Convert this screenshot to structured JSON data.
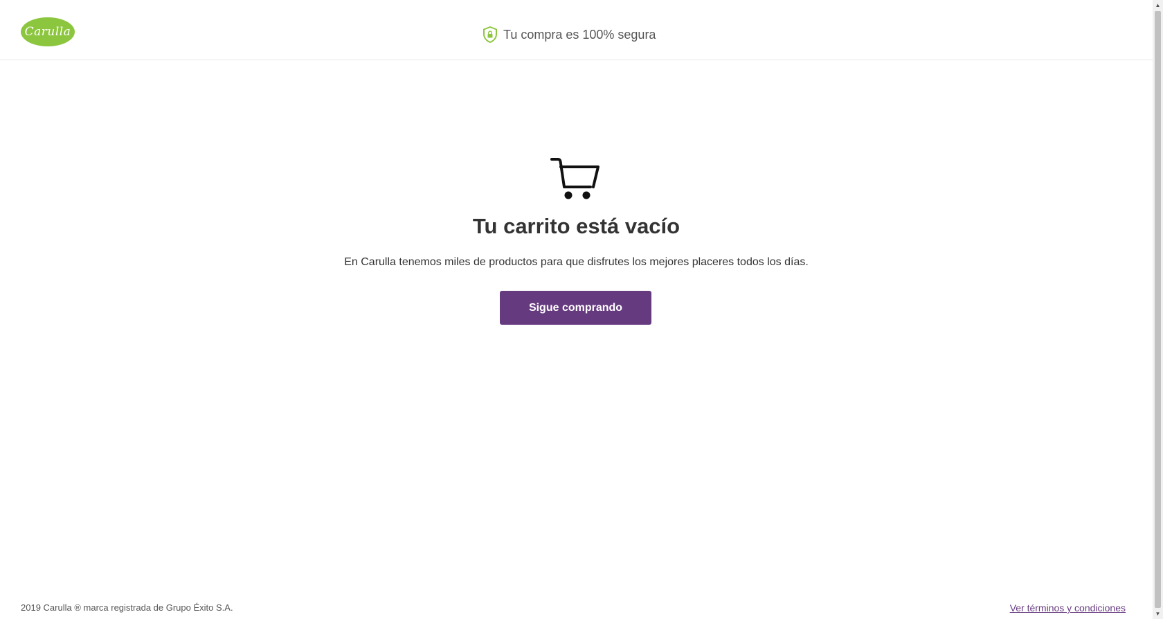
{
  "header": {
    "logo_text": "Carulla",
    "secure_text": "Tu compra es 100% segura",
    "secure_icon": "shield-lock-icon"
  },
  "main": {
    "cart_icon": "shopping-cart-icon",
    "title": "Tu carrito está vacío",
    "description": "En Carulla tenemos miles de productos para que disfrutes los mejores placeres todos los días.",
    "cta_label": "Sigue comprando"
  },
  "footer": {
    "copyright": "2019 Carulla ® marca registrada de Grupo Éxito S.A.",
    "terms_link": "Ver términos y condiciones"
  },
  "colors": {
    "brand_green": "#8cc63f",
    "brand_purple": "#663a7f"
  }
}
